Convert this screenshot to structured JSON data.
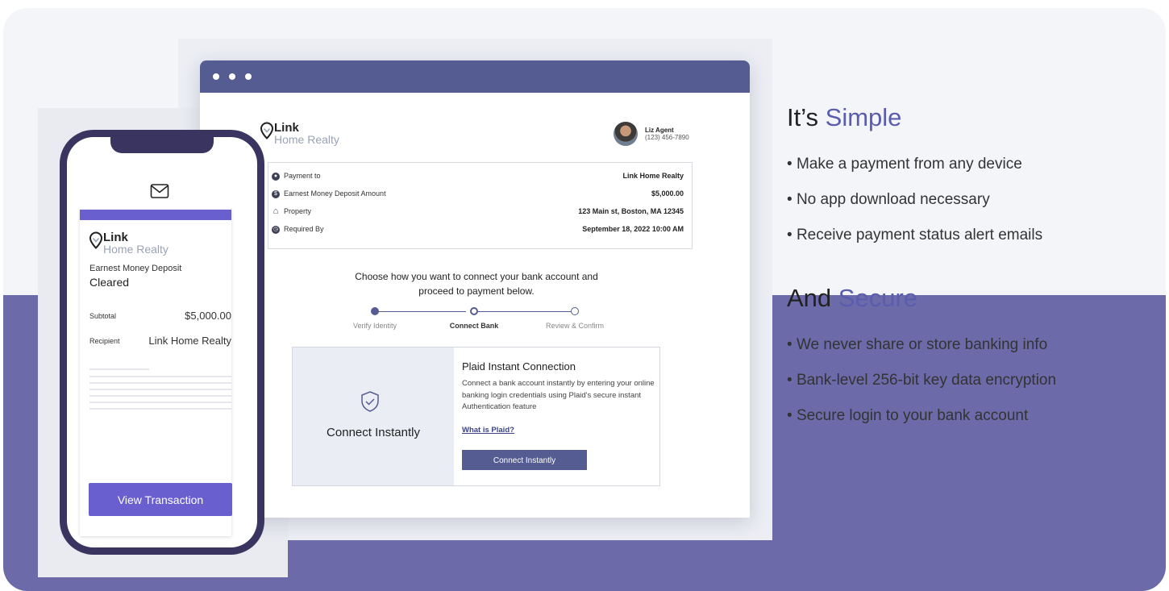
{
  "browser": {
    "logo": {
      "line1": "Link",
      "line2": "Home Realty"
    },
    "agent": {
      "name": "Liz Agent",
      "phone": "(123) 456-7890"
    },
    "details": [
      {
        "icon": "user-circle-icon",
        "label": "Payment to",
        "value": "Link Home Realty"
      },
      {
        "icon": "dollar-circle-icon",
        "label": "Earnest Money Deposit Amount",
        "value": "$5,000.00"
      },
      {
        "icon": "home-icon",
        "label": "Property",
        "value": "123 Main st, Boston, MA 12345"
      },
      {
        "icon": "clock-icon",
        "label": "Required By",
        "value": "September 18, 2022 10:00 AM"
      }
    ],
    "choose_line1": "Choose how you want to connect your bank account and",
    "choose_line2": "proceed to payment below.",
    "steps": [
      "Verify Identity",
      "Connect Bank",
      "Review & Confirm"
    ],
    "active_step": 1,
    "connect": {
      "left_label": "Connect Instantly",
      "title": "Plaid Instant Connection",
      "description": "Connect a bank account instantly by entering your online banking login credentials using Plaid's secure instant Authentication feature",
      "link": "What is Plaid?",
      "button": "Connect Instantly"
    }
  },
  "phone": {
    "logo": {
      "line1": "Link",
      "line2": "Home Realty"
    },
    "receipt_type": "Earnest Money Deposit",
    "status": "Cleared",
    "rows": [
      {
        "label": "Subtotal",
        "value": "$5,000.00"
      },
      {
        "label": "Recipient",
        "value": "Link Home Realty"
      }
    ],
    "button": "View Transaction"
  },
  "marketing": {
    "simple": {
      "prefix": "It’s ",
      "accent": "Simple",
      "bullets": [
        "Make a payment from any device",
        "No app download necessary",
        "Receive payment status alert emails"
      ]
    },
    "secure": {
      "prefix": "And ",
      "accent": "Secure",
      "bullets": [
        "We never share or store banking info",
        "Bank-level 256-bit key data encryption",
        "Secure login to your bank account"
      ]
    }
  },
  "colors": {
    "accent": "#5a5cae",
    "browser_bar": "#545c91",
    "phone_frame": "#3a3560",
    "button": "#6a5fcf",
    "band": "#6c6aa9"
  }
}
